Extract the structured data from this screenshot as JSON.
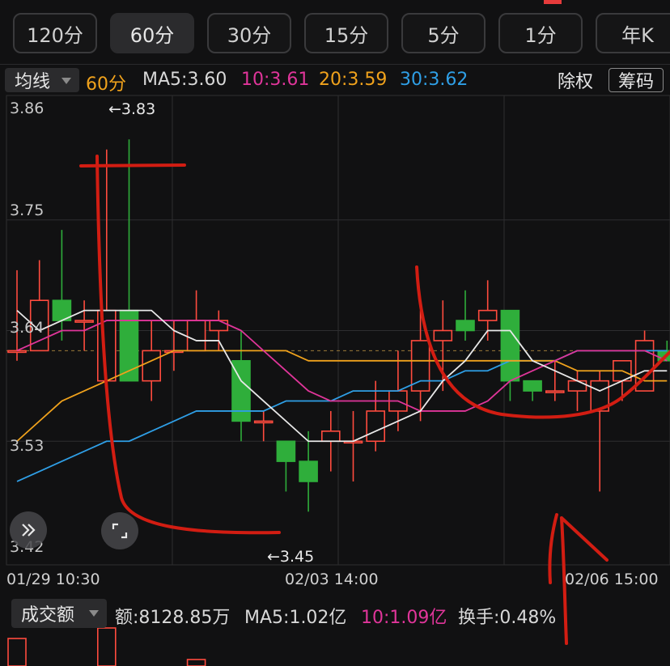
{
  "tabs": [
    "120分",
    "60分",
    "30分",
    "15分",
    "5分",
    "1分",
    "年K"
  ],
  "active_tab": "60分",
  "legend": {
    "selector": "均线",
    "period": "60分",
    "ma5": "MA5:3.60",
    "ma10": "10:3.61",
    "ma20": "20:3.59",
    "ma30": "30:3.62",
    "right_btn_1": "除权",
    "right_btn_2": "筹码"
  },
  "y_labels": [
    "3.86",
    "3.75",
    "3.64",
    "3.53",
    "3.42"
  ],
  "x_labels": [
    "01/29 10:30",
    "02/03 14:00",
    "02/06 15:00"
  ],
  "annotations": {
    "high": "←3.83",
    "low": "←3.45"
  },
  "volume_legend": {
    "selector": "成交额",
    "amount": "额:8128.85万",
    "ma5": "MA5:1.02亿",
    "ma10": "10:1.09亿",
    "turnover": "换手:0.48%"
  },
  "colors": {
    "up": "#ff4b3e",
    "down": "#2fae3b",
    "ma5": "#e8e8e8",
    "ma10": "#e0359a",
    "ma20": "#f0a21c",
    "ma30": "#2f9fe6",
    "drawing": "#d21d12",
    "period": "#f0a21c"
  },
  "icons": [
    "expand-double-chevron-icon",
    "fullscreen-corners-icon",
    "dropdown-caret-icon"
  ],
  "chart_data": {
    "type": "candlestick",
    "y_axis_ticks": [
      3.86,
      3.75,
      3.64,
      3.53,
      3.42
    ],
    "ylim": [
      3.42,
      3.86
    ],
    "last_price": 3.62,
    "high_marker": 3.83,
    "low_marker": 3.45,
    "candles": [
      {
        "o": 3.62,
        "c": 3.62,
        "h": 3.7,
        "l": 3.61
      },
      {
        "o": 3.62,
        "c": 3.67,
        "h": 3.71,
        "l": 3.62
      },
      {
        "o": 3.67,
        "c": 3.65,
        "h": 3.74,
        "l": 3.63
      },
      {
        "o": 3.65,
        "c": 3.65,
        "h": 3.67,
        "l": 3.62
      },
      {
        "o": 3.59,
        "c": 3.66,
        "h": 3.82,
        "l": 3.59
      },
      {
        "o": 3.66,
        "c": 3.59,
        "h": 3.83,
        "l": 3.59
      },
      {
        "o": 3.59,
        "c": 3.62,
        "h": 3.65,
        "l": 3.57
      },
      {
        "o": 3.62,
        "c": 3.62,
        "h": 3.65,
        "l": 3.6
      },
      {
        "o": 3.62,
        "c": 3.65,
        "h": 3.68,
        "l": 3.62
      },
      {
        "o": 3.64,
        "c": 3.65,
        "h": 3.66,
        "l": 3.62
      },
      {
        "o": 3.61,
        "c": 3.55,
        "h": 3.64,
        "l": 3.53
      },
      {
        "o": 3.55,
        "c": 3.55,
        "h": 3.56,
        "l": 3.53
      },
      {
        "o": 3.53,
        "c": 3.51,
        "h": 3.53,
        "l": 3.48
      },
      {
        "o": 3.51,
        "c": 3.49,
        "h": 3.54,
        "l": 3.46
      },
      {
        "o": 3.53,
        "c": 3.54,
        "h": 3.56,
        "l": 3.5
      },
      {
        "o": 3.53,
        "c": 3.53,
        "h": 3.56,
        "l": 3.49
      },
      {
        "o": 3.53,
        "c": 3.56,
        "h": 3.59,
        "l": 3.52
      },
      {
        "o": 3.56,
        "c": 3.58,
        "h": 3.62,
        "l": 3.54
      },
      {
        "o": 3.58,
        "c": 3.63,
        "h": 3.66,
        "l": 3.55
      },
      {
        "o": 3.63,
        "c": 3.64,
        "h": 3.67,
        "l": 3.58
      },
      {
        "o": 3.65,
        "c": 3.64,
        "h": 3.68,
        "l": 3.63
      },
      {
        "o": 3.65,
        "c": 3.66,
        "h": 3.69,
        "l": 3.63
      },
      {
        "o": 3.66,
        "c": 3.59,
        "h": 3.66,
        "l": 3.57
      },
      {
        "o": 3.59,
        "c": 3.58,
        "h": 3.59,
        "l": 3.57
      },
      {
        "o": 3.58,
        "c": 3.58,
        "h": 3.61,
        "l": 3.57
      },
      {
        "o": 3.58,
        "c": 3.59,
        "h": 3.6,
        "l": 3.56
      },
      {
        "o": 3.56,
        "c": 3.59,
        "h": 3.6,
        "l": 3.48
      },
      {
        "o": 3.59,
        "c": 3.61,
        "h": 3.61,
        "l": 3.57
      },
      {
        "o": 3.58,
        "c": 3.63,
        "h": 3.64,
        "l": 3.58
      },
      {
        "o": 3.62,
        "c": 3.61,
        "h": 3.63,
        "l": 3.61
      }
    ],
    "ma5": [
      3.66,
      3.64,
      3.65,
      3.66,
      3.66,
      3.66,
      3.66,
      3.64,
      3.63,
      3.63,
      3.59,
      3.57,
      3.55,
      3.53,
      3.53,
      3.53,
      3.54,
      3.55,
      3.56,
      3.59,
      3.61,
      3.64,
      3.64,
      3.61,
      3.6,
      3.59,
      3.58,
      3.59,
      3.6,
      3.6
    ],
    "ma10": [
      3.62,
      3.63,
      3.64,
      3.64,
      3.65,
      3.65,
      3.65,
      3.65,
      3.65,
      3.65,
      3.64,
      3.62,
      3.6,
      3.58,
      3.57,
      3.57,
      3.57,
      3.57,
      3.56,
      3.56,
      3.56,
      3.57,
      3.59,
      3.6,
      3.61,
      3.62,
      3.62,
      3.62,
      3.62,
      3.61
    ],
    "ma20": [
      3.53,
      3.55,
      3.57,
      3.58,
      3.59,
      3.6,
      3.61,
      3.62,
      3.62,
      3.62,
      3.62,
      3.62,
      3.62,
      3.61,
      3.61,
      3.61,
      3.61,
      3.61,
      3.61,
      3.61,
      3.61,
      3.61,
      3.61,
      3.61,
      3.61,
      3.6,
      3.6,
      3.6,
      3.59,
      3.59
    ],
    "ma30": [
      3.49,
      3.5,
      3.51,
      3.52,
      3.53,
      3.53,
      3.54,
      3.55,
      3.56,
      3.56,
      3.56,
      3.56,
      3.57,
      3.57,
      3.57,
      3.58,
      3.58,
      3.58,
      3.59,
      3.59,
      3.6,
      3.6,
      3.61,
      3.61,
      3.61,
      3.62,
      3.62,
      3.62,
      3.62,
      3.62
    ],
    "volume_up": [
      true,
      true,
      false,
      true,
      true,
      false,
      true,
      true,
      true,
      true,
      false,
      true,
      false,
      false,
      true,
      true,
      true,
      true,
      true,
      true,
      true,
      true,
      false,
      false,
      true,
      true,
      true,
      true,
      true,
      false
    ]
  }
}
